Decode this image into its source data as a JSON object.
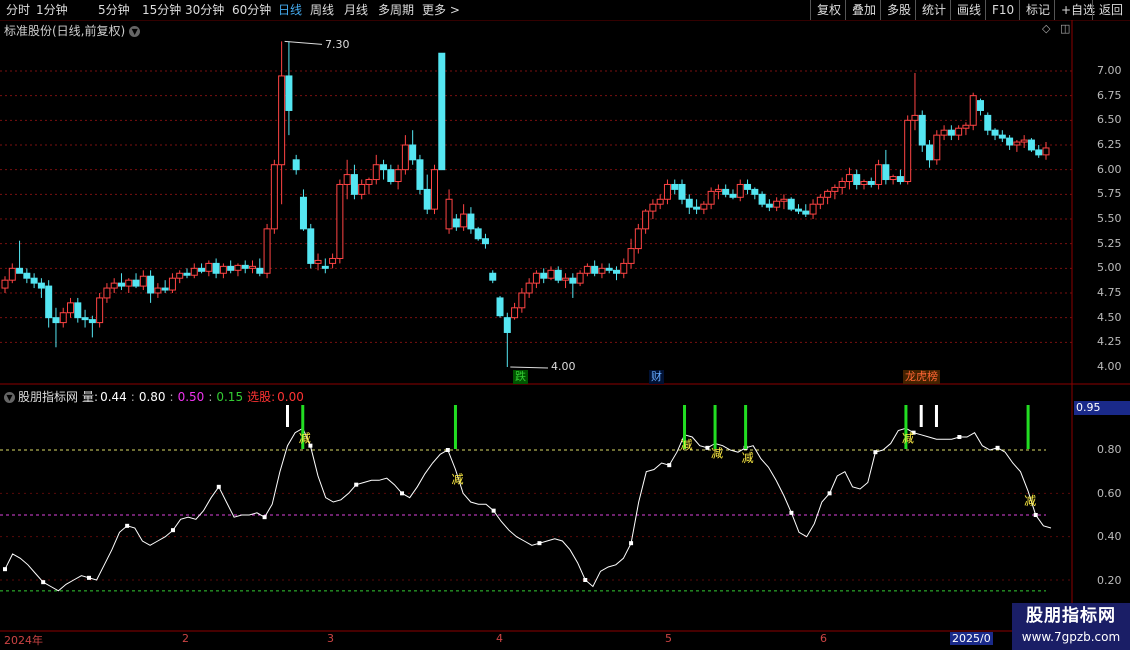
{
  "toolbar": {
    "periods": [
      "分时",
      "1分钟",
      "5分钟",
      "15分钟",
      "30分钟",
      "60分钟",
      "日线",
      "周线",
      "月线",
      "多周期",
      "更多 >"
    ],
    "active_period": "日线",
    "right_buttons": [
      "复权",
      "叠加",
      "多股",
      "统计",
      "画线",
      "F10",
      "标记",
      "+自选",
      "返回"
    ]
  },
  "stock": {
    "title": "标准股份(日线,前复权)"
  },
  "price_axis": {
    "ticks": [
      "7.00",
      "6.75",
      "6.50",
      "6.25",
      "6.00",
      "5.75",
      "5.50",
      "5.25",
      "5.00",
      "4.75",
      "4.50",
      "4.25",
      "4.00"
    ]
  },
  "annotations": {
    "high_label": "7.30",
    "low_label": "4.00"
  },
  "events": [
    {
      "label": "跌",
      "color": "#3c3"
    },
    {
      "label": "财",
      "color": "#6af"
    },
    {
      "label": "龙虎榜",
      "color": "#f63"
    }
  ],
  "indicator": {
    "name": "股朋指标网",
    "label_liang": "量:",
    "v1": "0.44",
    "v2": "0.80",
    "v3": "0.50",
    "v4": "0.15",
    "label_select": "选股:",
    "v5": "0.00",
    "current_value": "0.95",
    "axis": [
      "0.80",
      "0.60",
      "0.40",
      "0.20"
    ],
    "signal_label": "减"
  },
  "dates": [
    "2024年",
    "2",
    "3",
    "4",
    "5",
    "6",
    "2025/0"
  ],
  "watermark": {
    "line1": "股朋指标网",
    "line2": "www.7gpzb.com"
  },
  "colors": {
    "up": "#ff4444",
    "down": "#55e6f2",
    "grid": "#7a1010",
    "signal": "#22dd22",
    "line": "#ffffff"
  },
  "candles": [
    [
      4.8,
      4.92,
      4.75,
      4.88
    ],
    [
      4.88,
      5.05,
      4.85,
      5.0
    ],
    [
      5.0,
      5.28,
      4.95,
      4.95
    ],
    [
      4.95,
      5.0,
      4.85,
      4.9
    ],
    [
      4.9,
      4.95,
      4.8,
      4.85
    ],
    [
      4.85,
      4.9,
      4.7,
      4.8
    ],
    [
      4.82,
      4.88,
      4.4,
      4.5
    ],
    [
      4.5,
      4.6,
      4.2,
      4.45
    ],
    [
      4.45,
      4.6,
      4.4,
      4.55
    ],
    [
      4.55,
      4.7,
      4.5,
      4.65
    ],
    [
      4.65,
      4.7,
      4.45,
      4.5
    ],
    [
      4.5,
      4.58,
      4.4,
      4.48
    ],
    [
      4.48,
      4.52,
      4.3,
      4.45
    ],
    [
      4.45,
      4.75,
      4.4,
      4.7
    ],
    [
      4.7,
      4.85,
      4.65,
      4.8
    ],
    [
      4.8,
      4.9,
      4.75,
      4.85
    ],
    [
      4.85,
      4.95,
      4.78,
      4.82
    ],
    [
      4.82,
      4.9,
      4.75,
      4.88
    ],
    [
      4.88,
      4.95,
      4.8,
      4.82
    ],
    [
      4.82,
      4.98,
      4.78,
      4.92
    ],
    [
      4.92,
      4.98,
      4.65,
      4.75
    ],
    [
      4.75,
      4.85,
      4.7,
      4.8
    ],
    [
      4.8,
      4.88,
      4.75,
      4.78
    ],
    [
      4.78,
      4.95,
      4.75,
      4.9
    ],
    [
      4.9,
      4.98,
      4.85,
      4.95
    ],
    [
      4.95,
      5.0,
      4.9,
      4.93
    ],
    [
      4.93,
      5.05,
      4.9,
      5.0
    ],
    [
      5.0,
      5.05,
      4.95,
      4.97
    ],
    [
      4.97,
      5.08,
      4.92,
      5.05
    ],
    [
      5.05,
      5.1,
      4.9,
      4.95
    ],
    [
      4.95,
      5.05,
      4.9,
      5.02
    ],
    [
      5.02,
      5.08,
      4.95,
      4.98
    ],
    [
      4.98,
      5.05,
      4.92,
      5.03
    ],
    [
      5.03,
      5.08,
      4.95,
      5.0
    ],
    [
      5.0,
      5.08,
      4.95,
      5.02
    ],
    [
      5.0,
      5.1,
      4.92,
      4.95
    ],
    [
      4.95,
      5.45,
      4.9,
      5.4
    ],
    [
      5.4,
      6.1,
      5.35,
      6.05
    ],
    [
      6.05,
      7.3,
      5.65,
      6.95
    ],
    [
      6.95,
      7.3,
      6.35,
      6.6
    ],
    [
      6.1,
      6.15,
      5.95,
      6.0
    ],
    [
      5.72,
      5.8,
      5.38,
      5.4
    ],
    [
      5.4,
      5.45,
      5.0,
      5.05
    ],
    [
      5.05,
      5.15,
      4.98,
      5.08
    ],
    [
      5.02,
      5.1,
      4.95,
      5.0
    ],
    [
      5.05,
      5.15,
      5.0,
      5.1
    ],
    [
      5.1,
      5.9,
      5.05,
      5.85
    ],
    [
      5.85,
      6.1,
      5.7,
      5.95
    ],
    [
      5.95,
      6.05,
      5.7,
      5.75
    ],
    [
      5.75,
      5.9,
      5.7,
      5.85
    ],
    [
      5.85,
      5.92,
      5.75,
      5.9
    ],
    [
      5.9,
      6.15,
      5.85,
      6.05
    ],
    [
      6.05,
      6.1,
      5.9,
      6.0
    ],
    [
      6.0,
      6.05,
      5.85,
      5.88
    ],
    [
      5.88,
      6.05,
      5.8,
      6.0
    ],
    [
      6.0,
      6.35,
      5.95,
      6.25
    ],
    [
      6.25,
      6.4,
      6.05,
      6.1
    ],
    [
      6.1,
      6.15,
      5.75,
      5.8
    ],
    [
      5.8,
      5.95,
      5.55,
      5.6
    ],
    [
      5.6,
      6.05,
      5.55,
      6.0
    ],
    [
      7.18,
      7.18,
      6.0,
      6.0
    ],
    [
      5.4,
      5.8,
      5.35,
      5.7
    ],
    [
      5.5,
      5.55,
      5.38,
      5.42
    ],
    [
      5.42,
      5.65,
      5.38,
      5.55
    ],
    [
      5.55,
      5.62,
      5.35,
      5.4
    ],
    [
      5.4,
      5.42,
      5.28,
      5.3
    ],
    [
      5.3,
      5.35,
      5.2,
      5.25
    ],
    [
      4.95,
      4.98,
      4.85,
      4.88
    ],
    [
      4.7,
      4.72,
      4.5,
      4.52
    ],
    [
      4.5,
      4.55,
      4.0,
      4.35
    ],
    [
      4.5,
      4.65,
      4.48,
      4.6
    ],
    [
      4.6,
      4.8,
      4.55,
      4.75
    ],
    [
      4.75,
      4.9,
      4.7,
      4.85
    ],
    [
      4.85,
      4.98,
      4.8,
      4.95
    ],
    [
      4.95,
      5.0,
      4.85,
      4.9
    ],
    [
      4.9,
      5.02,
      4.88,
      4.98
    ],
    [
      4.98,
      5.02,
      4.85,
      4.88
    ],
    [
      4.88,
      4.95,
      4.8,
      4.9
    ],
    [
      4.9,
      4.95,
      4.7,
      4.85
    ],
    [
      4.85,
      4.98,
      4.82,
      4.95
    ],
    [
      4.95,
      5.05,
      4.92,
      5.02
    ],
    [
      5.02,
      5.08,
      4.92,
      4.95
    ],
    [
      4.95,
      5.05,
      4.9,
      5.0
    ],
    [
      5.0,
      5.05,
      4.95,
      4.98
    ],
    [
      4.98,
      5.02,
      4.88,
      4.95
    ],
    [
      4.95,
      5.1,
      4.9,
      5.05
    ],
    [
      5.05,
      5.3,
      5.0,
      5.2
    ],
    [
      5.2,
      5.45,
      5.15,
      5.4
    ],
    [
      5.4,
      5.6,
      5.35,
      5.58
    ],
    [
      5.58,
      5.7,
      5.5,
      5.65
    ],
    [
      5.65,
      5.75,
      5.6,
      5.7
    ],
    [
      5.7,
      5.9,
      5.65,
      5.85
    ],
    [
      5.85,
      5.9,
      5.75,
      5.8
    ],
    [
      5.85,
      5.9,
      5.65,
      5.7
    ],
    [
      5.7,
      5.75,
      5.55,
      5.62
    ],
    [
      5.62,
      5.7,
      5.55,
      5.6
    ],
    [
      5.6,
      5.68,
      5.55,
      5.65
    ],
    [
      5.65,
      5.82,
      5.6,
      5.78
    ],
    [
      5.78,
      5.85,
      5.7,
      5.8
    ],
    [
      5.8,
      5.85,
      5.72,
      5.75
    ],
    [
      5.75,
      5.8,
      5.7,
      5.72
    ],
    [
      5.72,
      5.9,
      5.68,
      5.85
    ],
    [
      5.85,
      5.9,
      5.75,
      5.8
    ],
    [
      5.8,
      5.82,
      5.7,
      5.75
    ],
    [
      5.75,
      5.78,
      5.62,
      5.65
    ],
    [
      5.65,
      5.7,
      5.58,
      5.62
    ],
    [
      5.62,
      5.72,
      5.58,
      5.68
    ],
    [
      5.68,
      5.75,
      5.6,
      5.7
    ],
    [
      5.7,
      5.72,
      5.58,
      5.6
    ],
    [
      5.6,
      5.65,
      5.55,
      5.58
    ],
    [
      5.58,
      5.65,
      5.52,
      5.55
    ],
    [
      5.55,
      5.7,
      5.5,
      5.65
    ],
    [
      5.65,
      5.75,
      5.6,
      5.72
    ],
    [
      5.72,
      5.8,
      5.65,
      5.78
    ],
    [
      5.78,
      5.85,
      5.7,
      5.82
    ],
    [
      5.82,
      5.92,
      5.75,
      5.88
    ],
    [
      5.88,
      6.02,
      5.8,
      5.95
    ],
    [
      5.95,
      6.0,
      5.8,
      5.85
    ],
    [
      5.85,
      5.9,
      5.8,
      5.88
    ],
    [
      5.88,
      5.92,
      5.82,
      5.85
    ],
    [
      5.85,
      6.1,
      5.8,
      6.05
    ],
    [
      6.05,
      6.2,
      5.85,
      5.9
    ],
    [
      5.9,
      5.95,
      5.85,
      5.93
    ],
    [
      5.93,
      6.0,
      5.85,
      5.88
    ],
    [
      5.88,
      6.55,
      5.85,
      6.5
    ],
    [
      6.5,
      6.98,
      6.4,
      6.55
    ],
    [
      6.55,
      6.6,
      6.18,
      6.25
    ],
    [
      6.25,
      6.3,
      6.02,
      6.1
    ],
    [
      6.1,
      6.4,
      6.05,
      6.35
    ],
    [
      6.35,
      6.45,
      6.3,
      6.4
    ],
    [
      6.4,
      6.45,
      6.3,
      6.35
    ],
    [
      6.35,
      6.45,
      6.3,
      6.42
    ],
    [
      6.42,
      6.48,
      6.35,
      6.45
    ],
    [
      6.45,
      6.78,
      6.4,
      6.75
    ],
    [
      6.7,
      6.72,
      6.55,
      6.6
    ],
    [
      6.55,
      6.58,
      6.35,
      6.4
    ],
    [
      6.4,
      6.42,
      6.3,
      6.35
    ],
    [
      6.35,
      6.4,
      6.28,
      6.32
    ],
    [
      6.32,
      6.35,
      6.2,
      6.25
    ],
    [
      6.25,
      6.3,
      6.18,
      6.28
    ],
    [
      6.28,
      6.35,
      6.22,
      6.3
    ],
    [
      6.3,
      6.32,
      6.18,
      6.2
    ],
    [
      6.2,
      6.25,
      6.12,
      6.15
    ],
    [
      6.15,
      6.28,
      6.1,
      6.22
    ]
  ],
  "indicator_series": [
    0.25,
    0.32,
    0.3,
    0.27,
    0.23,
    0.19,
    0.17,
    0.15,
    0.18,
    0.2,
    0.22,
    0.21,
    0.2,
    0.27,
    0.34,
    0.42,
    0.45,
    0.44,
    0.38,
    0.36,
    0.38,
    0.4,
    0.43,
    0.48,
    0.49,
    0.48,
    0.52,
    0.58,
    0.63,
    0.56,
    0.49,
    0.5,
    0.5,
    0.51,
    0.49,
    0.55,
    0.7,
    0.82,
    0.88,
    0.9,
    0.82,
    0.68,
    0.58,
    0.56,
    0.57,
    0.6,
    0.64,
    0.65,
    0.66,
    0.66,
    0.67,
    0.64,
    0.6,
    0.58,
    0.63,
    0.69,
    0.74,
    0.78,
    0.8,
    0.71,
    0.6,
    0.56,
    0.55,
    0.55,
    0.52,
    0.47,
    0.43,
    0.4,
    0.38,
    0.36,
    0.37,
    0.38,
    0.39,
    0.38,
    0.34,
    0.28,
    0.2,
    0.17,
    0.24,
    0.26,
    0.27,
    0.3,
    0.37,
    0.56,
    0.7,
    0.71,
    0.74,
    0.73,
    0.79,
    0.87,
    0.86,
    0.82,
    0.81,
    0.83,
    0.82,
    0.8,
    0.79,
    0.81,
    0.82,
    0.76,
    0.72,
    0.66,
    0.59,
    0.51,
    0.42,
    0.4,
    0.46,
    0.56,
    0.6,
    0.68,
    0.7,
    0.63,
    0.62,
    0.65,
    0.79,
    0.8,
    0.83,
    0.89,
    0.9,
    0.88,
    0.87,
    0.86,
    0.85,
    0.85,
    0.85,
    0.86,
    0.86,
    0.88,
    0.82,
    0.8,
    0.81,
    0.79,
    0.74,
    0.7,
    0.61,
    0.5,
    0.45,
    0.44
  ],
  "indicator_white_markers": [
    0,
    5,
    11,
    16,
    22,
    28,
    34,
    40,
    46,
    52,
    58,
    64,
    70,
    76,
    82,
    87,
    92,
    97,
    103,
    108,
    114,
    119,
    125,
    130,
    135
  ],
  "green_bars_at": [
    39,
    59,
    89,
    93,
    97,
    118,
    134
  ],
  "white_bars_at": [
    37,
    120,
    122
  ]
}
